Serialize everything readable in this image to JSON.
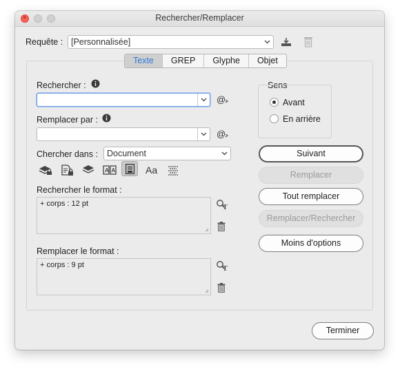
{
  "window": {
    "title": "Rechercher/Remplacer"
  },
  "query": {
    "label": "Requête :",
    "value": "[Personnalisée]"
  },
  "tabs": [
    "Texte",
    "GREP",
    "Glyphe",
    "Objet"
  ],
  "search": {
    "label": "Rechercher :",
    "value": ""
  },
  "replace": {
    "label": "Remplacer par :",
    "value": ""
  },
  "search_in": {
    "label": "Chercher dans :",
    "value": "Document"
  },
  "direction": {
    "label": "Sens",
    "options": [
      "Avant",
      "En arrière"
    ],
    "selected": "Avant"
  },
  "buttons": {
    "next": "Suivant",
    "replace": "Remplacer",
    "replace_all": "Tout remplacer",
    "replace_find": "Remplacer/Rechercher",
    "fewer_options": "Moins d'options",
    "done": "Terminer"
  },
  "find_format": {
    "label": "Rechercher le format :",
    "value": "+ corps : 12 pt"
  },
  "replace_format": {
    "label": "Remplacer le format :",
    "value": "+ corps : 9 pt"
  },
  "colors": {
    "active_tab_text": "#2f7ad6",
    "focus_ring": "#6a9be0",
    "close_button": "#fc5f57"
  },
  "icons": [
    "save-query-icon",
    "delete-query-icon",
    "info-icon",
    "special-characters-icon",
    "locked-layers-icon",
    "locked-stories-icon",
    "hidden-layers-icon",
    "master-pages-icon",
    "footnotes-icon",
    "case-sensitive-icon",
    "whole-word-icon",
    "specify-attributes-icon",
    "trash-icon"
  ]
}
